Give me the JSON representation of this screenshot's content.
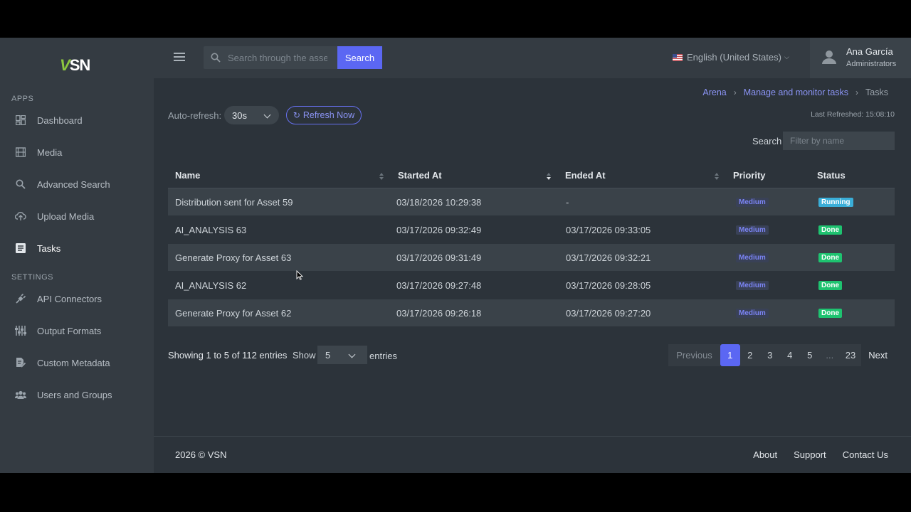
{
  "app": {
    "logo_v": "V",
    "logo_sn": "SN"
  },
  "sidebar": {
    "apps_title": "APPS",
    "settings_title": "SETTINGS",
    "apps": [
      {
        "label": "Dashboard",
        "icon": "dashboard-icon"
      },
      {
        "label": "Media",
        "icon": "film-icon"
      },
      {
        "label": "Advanced Search",
        "icon": "search-icon"
      },
      {
        "label": "Upload Media",
        "icon": "cloud-upload-icon"
      },
      {
        "label": "Tasks",
        "icon": "tasks-icon",
        "active": true
      }
    ],
    "settings": [
      {
        "label": "API Connectors",
        "icon": "plug-icon"
      },
      {
        "label": "Output Formats",
        "icon": "sliders-icon"
      },
      {
        "label": "Custom Metadata",
        "icon": "file-edit-icon"
      },
      {
        "label": "Users and Groups",
        "icon": "users-icon"
      }
    ]
  },
  "header": {
    "search_placeholder": "Search through the assets",
    "search_button": "Search",
    "language": "English (United States)",
    "user_name": "Ana García",
    "user_role": "Administrators"
  },
  "breadcrumb": {
    "items": [
      "Arena",
      "Manage and monitor tasks"
    ],
    "current": "Tasks"
  },
  "controls": {
    "auto_refresh_label": "Auto-refresh:",
    "auto_refresh_value": "30s",
    "refresh_button": "Refresh Now",
    "last_refreshed": "Last Refreshed: 15:08:10",
    "filter_label": "Search",
    "filter_placeholder": "Filter by name"
  },
  "table": {
    "columns": [
      "Name",
      "Started At",
      "Ended At",
      "Priority",
      "Status"
    ],
    "rows": [
      {
        "name": "Distribution sent for Asset 59",
        "started": "03/18/2026 10:29:38",
        "ended": "-",
        "priority": "Medium",
        "status": "Running"
      },
      {
        "name": "AI_ANALYSIS 63",
        "started": "03/17/2026 09:32:49",
        "ended": "03/17/2026 09:33:05",
        "priority": "Medium",
        "status": "Done"
      },
      {
        "name": "Generate Proxy for Asset 63",
        "started": "03/17/2026 09:31:49",
        "ended": "03/17/2026 09:32:21",
        "priority": "Medium",
        "status": "Done"
      },
      {
        "name": "AI_ANALYSIS 62",
        "started": "03/17/2026 09:27:48",
        "ended": "03/17/2026 09:28:05",
        "priority": "Medium",
        "status": "Done"
      },
      {
        "name": "Generate Proxy for Asset 62",
        "started": "03/17/2026 09:26:18",
        "ended": "03/17/2026 09:27:20",
        "priority": "Medium",
        "status": "Done"
      }
    ]
  },
  "pagination": {
    "showing": "Showing 1 to 5 of 112 entries",
    "show_label": "Show",
    "page_size": "5",
    "entries_label": "entries",
    "previous": "Previous",
    "pages": [
      "1",
      "2",
      "3",
      "4",
      "5"
    ],
    "ellipsis": "...",
    "last_page": "23",
    "next": "Next"
  },
  "footer": {
    "copyright": "2026 © VSN",
    "links": [
      "About",
      "Support",
      "Contact Us"
    ]
  },
  "colors": {
    "accent": "#5b67f3",
    "running": "#3aaed8",
    "done": "#1ec370",
    "logo_green": "#8cc63f"
  }
}
